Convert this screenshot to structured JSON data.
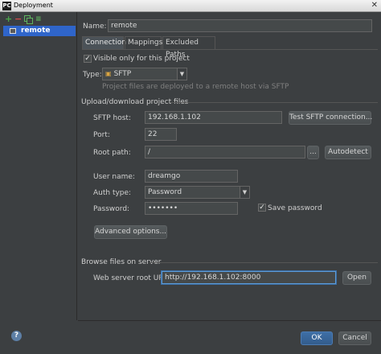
{
  "window": {
    "title": "Deployment",
    "close_glyph": "✕"
  },
  "toolbar": {
    "add": "+",
    "remove": "−",
    "copy": "copy-icon",
    "default": "≡"
  },
  "servers": [
    {
      "label": "remote",
      "selected": true
    }
  ],
  "name": {
    "label": "Name:",
    "value": "remote"
  },
  "tabs": [
    {
      "label": "Connection",
      "active": true
    },
    {
      "label": "Mappings",
      "active": false
    },
    {
      "label": "Excluded Paths",
      "active": false
    }
  ],
  "visible_only": {
    "label": "Visible only for this project",
    "checked": true
  },
  "type": {
    "label": "Type:",
    "value": "SFTP",
    "hint": "Project files are deployed to a remote host via SFTP"
  },
  "upload_section": {
    "title": "Upload/download project files"
  },
  "sftp_host": {
    "label": "SFTP host:",
    "value": "192.168.1.102",
    "test_button": "Test SFTP connection..."
  },
  "port": {
    "label": "Port:",
    "value": "22"
  },
  "root_path": {
    "label": "Root path:",
    "value": "/",
    "browse_button": "...",
    "autodetect_button": "Autodetect"
  },
  "user_name": {
    "label": "User name:",
    "value": "dreamgo"
  },
  "auth_type": {
    "label": "Auth type:",
    "value": "Password"
  },
  "password": {
    "label": "Password:",
    "value": "•••••••",
    "save_label": "Save password",
    "save_checked": true
  },
  "advanced_button": "Advanced options...",
  "browse_section": {
    "title": "Browse files on server"
  },
  "web_root": {
    "label": "Web server root URL:",
    "value": "http://192.168.1.102:8000",
    "open_button": "Open"
  },
  "footer": {
    "help": "?",
    "ok": "OK",
    "cancel": "Cancel"
  },
  "colors": {
    "accent": "#2f65ca",
    "background": "#3c3f41",
    "field_bg": "#45494a"
  }
}
